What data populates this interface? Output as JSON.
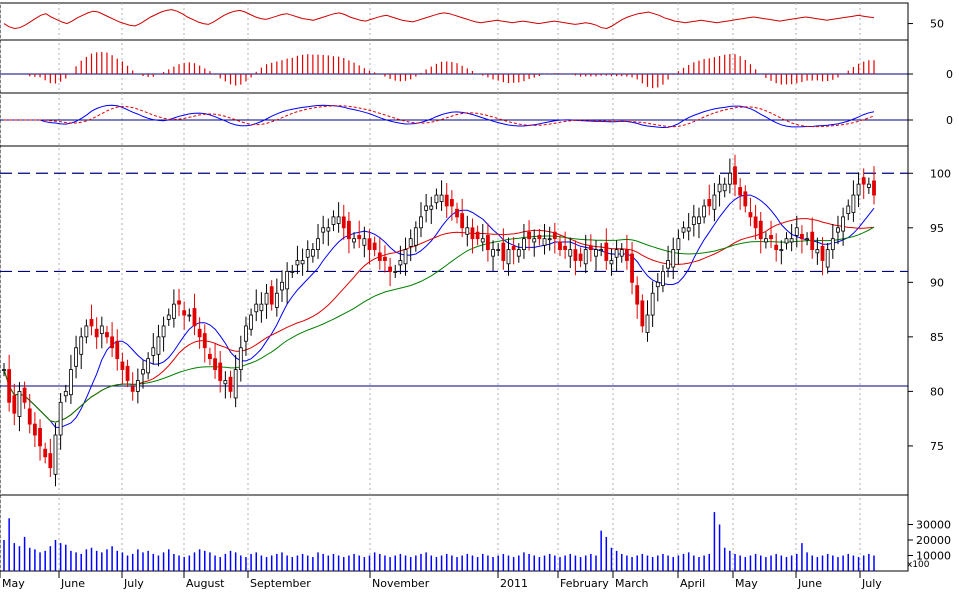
{
  "chart_data": {
    "type": "candlestick",
    "x_labels": [
      "May",
      "June",
      "July",
      "August",
      "September",
      "November",
      "2011",
      "February",
      "March",
      "April",
      "May",
      "June",
      "July"
    ],
    "price_panel": {
      "ylim": [
        70.5,
        102.5
      ],
      "yticks": [
        75,
        80,
        85,
        90,
        95,
        100
      ],
      "support_line": 80.5,
      "dashed_lines": [
        91,
        100
      ],
      "candles_close": [
        82,
        79,
        78,
        80,
        79,
        77,
        76,
        75,
        74,
        73,
        76,
        79,
        80,
        82,
        84,
        85,
        86,
        86,
        85,
        86,
        85,
        84,
        83,
        82,
        81,
        80,
        81,
        82,
        83,
        84,
        85,
        86,
        87,
        88,
        88,
        87,
        87,
        86,
        85,
        84,
        83,
        82,
        81,
        81,
        80,
        82,
        84,
        86,
        87,
        88,
        88,
        89,
        88,
        89,
        90,
        91,
        91,
        92,
        92,
        93,
        93,
        94,
        95,
        95,
        96,
        96,
        95,
        94,
        94,
        94,
        94,
        93,
        93,
        92,
        92,
        91,
        91,
        92,
        93,
        94,
        95,
        96,
        97,
        97,
        98,
        98,
        97,
        97,
        96,
        95,
        95,
        94,
        94,
        94,
        93,
        93,
        93,
        92,
        93,
        93,
        93,
        94,
        94,
        94,
        94,
        94,
        94,
        94,
        93,
        93,
        93,
        92,
        92,
        93,
        93,
        93,
        93,
        92,
        92,
        93,
        93,
        92,
        90,
        88,
        86,
        87,
        89,
        90,
        91,
        92,
        93,
        94,
        95,
        95,
        96,
        96,
        97,
        97,
        98,
        99,
        99,
        100,
        99,
        98,
        97,
        96,
        95,
        94,
        94,
        94,
        93,
        93,
        94,
        94,
        95,
        94,
        94,
        93,
        93,
        92,
        93,
        94,
        95,
        96,
        97,
        98,
        99,
        99,
        99,
        98
      ]
    },
    "volume_panel": {
      "yticks": [
        10000,
        20000,
        30000
      ],
      "multiplier_label": "x100",
      "values": [
        200,
        340,
        180,
        160,
        220,
        150,
        140,
        120,
        130,
        160,
        200,
        180,
        170,
        130,
        120,
        110,
        140,
        150,
        130,
        120,
        140,
        160,
        130,
        120,
        100,
        110,
        140,
        120,
        130,
        110,
        100,
        120,
        140,
        110,
        100,
        90,
        100,
        120,
        140,
        130,
        120,
        100,
        90,
        110,
        130,
        120,
        100,
        90,
        110,
        120,
        100,
        90,
        100,
        110,
        120,
        100,
        90,
        100,
        110,
        100,
        90,
        120,
        110,
        100,
        110,
        100,
        90,
        100,
        110,
        100,
        90,
        100,
        120,
        110,
        100,
        90,
        100,
        110,
        100,
        90,
        100,
        110,
        120,
        100,
        90,
        100,
        110,
        100,
        90,
        100,
        110,
        100,
        90,
        110,
        100,
        90,
        100,
        110,
        100,
        90,
        100,
        120,
        110,
        100,
        90,
        100,
        110,
        100,
        90,
        100,
        110,
        100,
        90,
        100,
        110,
        100,
        260,
        220,
        150,
        130,
        110,
        100,
        90,
        100,
        110,
        100,
        90,
        100,
        110,
        100,
        90,
        100,
        110,
        120,
        100,
        90,
        100,
        110,
        380,
        300,
        150,
        130,
        110,
        100,
        90,
        100,
        110,
        100,
        90,
        100,
        110,
        100,
        90,
        100,
        110,
        180,
        120,
        100,
        90,
        100,
        110,
        100,
        90,
        100,
        110,
        100,
        90,
        100,
        110,
        100
      ]
    },
    "indicators": {
      "rsi": {
        "yticks": [
          50
        ],
        "values": [
          50,
          46,
          44,
          45,
          48,
          52,
          56,
          60,
          62,
          58,
          55,
          52,
          50,
          53,
          57,
          60,
          63,
          65,
          64,
          61,
          58,
          55,
          52,
          50,
          48,
          47,
          50,
          54,
          58,
          61,
          64,
          66,
          67,
          65,
          62,
          58,
          55,
          52,
          50,
          49,
          52,
          56,
          60,
          63,
          65,
          66,
          64,
          61,
          58,
          56,
          55,
          57,
          59,
          61,
          62,
          60,
          58,
          56,
          55,
          54,
          56,
          58,
          60,
          62,
          63,
          61,
          58,
          56,
          54,
          53,
          55,
          57,
          59,
          60,
          58,
          56,
          54,
          53,
          52,
          54,
          56,
          58,
          60,
          62,
          63,
          62,
          60,
          58,
          56,
          54,
          52,
          51,
          52,
          53,
          54,
          53,
          52,
          51,
          52,
          53,
          52,
          51,
          50,
          51,
          52,
          53,
          52,
          51,
          50,
          49,
          50,
          51,
          50,
          48,
          45,
          44,
          47,
          51,
          55,
          58,
          60,
          62,
          63,
          64,
          62,
          60,
          57,
          55,
          53,
          52,
          51,
          52,
          53,
          54,
          53,
          52,
          51,
          52,
          53,
          54,
          55,
          56,
          57,
          58,
          57,
          56,
          55,
          54,
          53,
          54,
          55,
          56,
          57,
          58,
          57,
          56,
          55,
          54,
          55,
          56,
          57,
          58,
          59,
          60,
          59,
          58,
          57
        ]
      },
      "histogram": {
        "yticks": [
          0
        ]
      },
      "oscillator": {
        "yticks": [
          0
        ]
      }
    }
  }
}
